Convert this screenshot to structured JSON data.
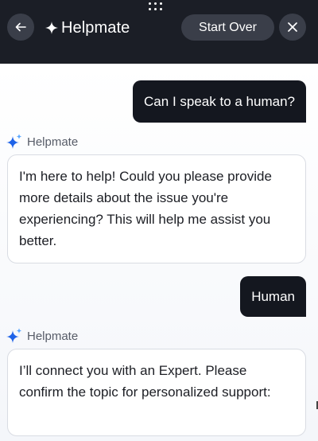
{
  "header": {
    "title": "Helpmate",
    "start_over_label": "Start Over"
  },
  "messages": [
    {
      "role": "user",
      "text": "Can I speak to a human?"
    },
    {
      "role": "bot",
      "sender": "Helpmate",
      "text": "I'm here to help! Could you please provide more details about the issue you're experiencing? This will help me assist you better."
    },
    {
      "role": "user",
      "text": "Human"
    },
    {
      "role": "bot",
      "sender": "Helpmate",
      "text": "I’ll connect you with an Expert. Please confirm the topic for personalized support:"
    }
  ],
  "colors": {
    "header_bg": "#1b1e26",
    "user_bubble_bg": "#14171f",
    "sparkle_blue": "#1f63e8",
    "sparkle_light": "#5da8ff"
  }
}
